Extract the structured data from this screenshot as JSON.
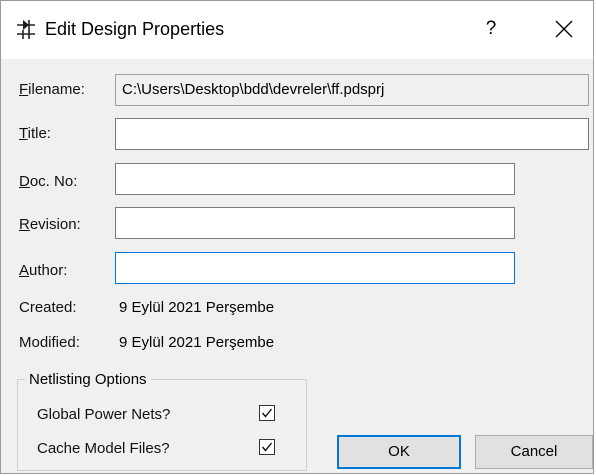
{
  "window": {
    "title": "Edit Design Properties",
    "help_symbol": "?",
    "close_icon": "close-icon",
    "app_icon": "design-properties-icon"
  },
  "form": {
    "filename_label": "Filename:",
    "filename_value": "C:\\Users\\Desktop\\bdd\\devreler\\ff.pdsprj",
    "title_label": "Title:",
    "title_value": "",
    "docno_label": "Doc. No:",
    "docno_value": "",
    "revision_label": "Revision:",
    "revision_value": "",
    "author_label": "Author:",
    "author_value": "",
    "created_label": "Created:",
    "created_value": "9 Eylül 2021 Perşembe",
    "modified_label": "Modified:",
    "modified_value": "9 Eylül 2021 Perşembe"
  },
  "netlisting": {
    "group_label": "Netlisting Options",
    "global_power_nets_label": "Global Power Nets?",
    "global_power_nets_checked": true,
    "cache_model_files_label": "Cache Model Files?",
    "cache_model_files_checked": true
  },
  "buttons": {
    "ok_label": "OK",
    "cancel_label": "Cancel"
  },
  "colors": {
    "focus_border": "#0078d7",
    "dialog_background": "#f0f0f0"
  }
}
